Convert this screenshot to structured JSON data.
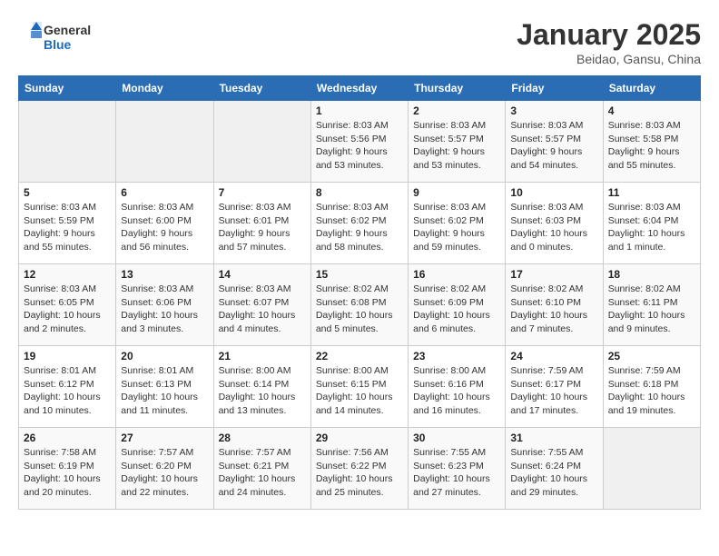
{
  "header": {
    "logo_general": "General",
    "logo_blue": "Blue",
    "title": "January 2025",
    "subtitle": "Beidao, Gansu, China"
  },
  "weekdays": [
    "Sunday",
    "Monday",
    "Tuesday",
    "Wednesday",
    "Thursday",
    "Friday",
    "Saturday"
  ],
  "weeks": [
    [
      {
        "day": "",
        "info": ""
      },
      {
        "day": "",
        "info": ""
      },
      {
        "day": "",
        "info": ""
      },
      {
        "day": "1",
        "info": "Sunrise: 8:03 AM\nSunset: 5:56 PM\nDaylight: 9 hours\nand 53 minutes."
      },
      {
        "day": "2",
        "info": "Sunrise: 8:03 AM\nSunset: 5:57 PM\nDaylight: 9 hours\nand 53 minutes."
      },
      {
        "day": "3",
        "info": "Sunrise: 8:03 AM\nSunset: 5:57 PM\nDaylight: 9 hours\nand 54 minutes."
      },
      {
        "day": "4",
        "info": "Sunrise: 8:03 AM\nSunset: 5:58 PM\nDaylight: 9 hours\nand 55 minutes."
      }
    ],
    [
      {
        "day": "5",
        "info": "Sunrise: 8:03 AM\nSunset: 5:59 PM\nDaylight: 9 hours\nand 55 minutes."
      },
      {
        "day": "6",
        "info": "Sunrise: 8:03 AM\nSunset: 6:00 PM\nDaylight: 9 hours\nand 56 minutes."
      },
      {
        "day": "7",
        "info": "Sunrise: 8:03 AM\nSunset: 6:01 PM\nDaylight: 9 hours\nand 57 minutes."
      },
      {
        "day": "8",
        "info": "Sunrise: 8:03 AM\nSunset: 6:02 PM\nDaylight: 9 hours\nand 58 minutes."
      },
      {
        "day": "9",
        "info": "Sunrise: 8:03 AM\nSunset: 6:02 PM\nDaylight: 9 hours\nand 59 minutes."
      },
      {
        "day": "10",
        "info": "Sunrise: 8:03 AM\nSunset: 6:03 PM\nDaylight: 10 hours\nand 0 minutes."
      },
      {
        "day": "11",
        "info": "Sunrise: 8:03 AM\nSunset: 6:04 PM\nDaylight: 10 hours\nand 1 minute."
      }
    ],
    [
      {
        "day": "12",
        "info": "Sunrise: 8:03 AM\nSunset: 6:05 PM\nDaylight: 10 hours\nand 2 minutes."
      },
      {
        "day": "13",
        "info": "Sunrise: 8:03 AM\nSunset: 6:06 PM\nDaylight: 10 hours\nand 3 minutes."
      },
      {
        "day": "14",
        "info": "Sunrise: 8:03 AM\nSunset: 6:07 PM\nDaylight: 10 hours\nand 4 minutes."
      },
      {
        "day": "15",
        "info": "Sunrise: 8:02 AM\nSunset: 6:08 PM\nDaylight: 10 hours\nand 5 minutes."
      },
      {
        "day": "16",
        "info": "Sunrise: 8:02 AM\nSunset: 6:09 PM\nDaylight: 10 hours\nand 6 minutes."
      },
      {
        "day": "17",
        "info": "Sunrise: 8:02 AM\nSunset: 6:10 PM\nDaylight: 10 hours\nand 7 minutes."
      },
      {
        "day": "18",
        "info": "Sunrise: 8:02 AM\nSunset: 6:11 PM\nDaylight: 10 hours\nand 9 minutes."
      }
    ],
    [
      {
        "day": "19",
        "info": "Sunrise: 8:01 AM\nSunset: 6:12 PM\nDaylight: 10 hours\nand 10 minutes."
      },
      {
        "day": "20",
        "info": "Sunrise: 8:01 AM\nSunset: 6:13 PM\nDaylight: 10 hours\nand 11 minutes."
      },
      {
        "day": "21",
        "info": "Sunrise: 8:00 AM\nSunset: 6:14 PM\nDaylight: 10 hours\nand 13 minutes."
      },
      {
        "day": "22",
        "info": "Sunrise: 8:00 AM\nSunset: 6:15 PM\nDaylight: 10 hours\nand 14 minutes."
      },
      {
        "day": "23",
        "info": "Sunrise: 8:00 AM\nSunset: 6:16 PM\nDaylight: 10 hours\nand 16 minutes."
      },
      {
        "day": "24",
        "info": "Sunrise: 7:59 AM\nSunset: 6:17 PM\nDaylight: 10 hours\nand 17 minutes."
      },
      {
        "day": "25",
        "info": "Sunrise: 7:59 AM\nSunset: 6:18 PM\nDaylight: 10 hours\nand 19 minutes."
      }
    ],
    [
      {
        "day": "26",
        "info": "Sunrise: 7:58 AM\nSunset: 6:19 PM\nDaylight: 10 hours\nand 20 minutes."
      },
      {
        "day": "27",
        "info": "Sunrise: 7:57 AM\nSunset: 6:20 PM\nDaylight: 10 hours\nand 22 minutes."
      },
      {
        "day": "28",
        "info": "Sunrise: 7:57 AM\nSunset: 6:21 PM\nDaylight: 10 hours\nand 24 minutes."
      },
      {
        "day": "29",
        "info": "Sunrise: 7:56 AM\nSunset: 6:22 PM\nDaylight: 10 hours\nand 25 minutes."
      },
      {
        "day": "30",
        "info": "Sunrise: 7:55 AM\nSunset: 6:23 PM\nDaylight: 10 hours\nand 27 minutes."
      },
      {
        "day": "31",
        "info": "Sunrise: 7:55 AM\nSunset: 6:24 PM\nDaylight: 10 hours\nand 29 minutes."
      },
      {
        "day": "",
        "info": ""
      }
    ]
  ]
}
